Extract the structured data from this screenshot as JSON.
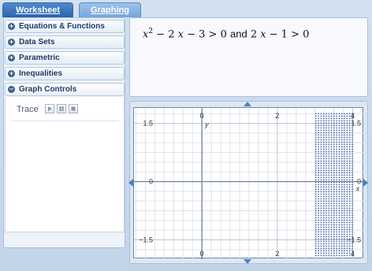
{
  "tabs": {
    "worksheet": "Worksheet",
    "graphing": "Graphing"
  },
  "sidebar": {
    "items": [
      {
        "label": "Equations & Functions",
        "icon": "plus-circle-icon"
      },
      {
        "label": "Data Sets",
        "icon": "plus-circle-icon"
      },
      {
        "label": "Parametric",
        "icon": "plus-circle-icon"
      },
      {
        "label": "Inequalities",
        "icon": "plus-circle-icon"
      },
      {
        "label": "Graph Controls",
        "icon": "minus-circle-icon"
      }
    ],
    "graph_controls": {
      "trace_label": "Trace",
      "buttons": [
        "play-icon",
        "pause-icon",
        "stop-icon"
      ]
    }
  },
  "expression": {
    "part1_var1": "x",
    "part1_exp": "2",
    "part1_rest": " − 2 ",
    "part1_var2": "x",
    "part1_tail": " − 3 > 0",
    "connector": "and",
    "part2_lead": "2 ",
    "part2_var": "x",
    "part2_tail": " − 1 > 0"
  },
  "graph": {
    "x_tick_labels": [
      "0",
      "2",
      "4"
    ],
    "y_tick_labels": [
      "1.5",
      "0",
      "−1.5"
    ],
    "x_axis_name": "x",
    "y_axis_name": "y",
    "x_range": [
      -1.8,
      4.3
    ],
    "y_range": [
      -2.0,
      1.9
    ],
    "shaded_region": "x > 3",
    "colors": {
      "grid_minor": "#dde3ea",
      "grid_major": "#b9c3cf",
      "axis": "#6b7c92",
      "shade_dots": "#3f67a8",
      "nav_arrow": "#4f7fc0"
    }
  }
}
